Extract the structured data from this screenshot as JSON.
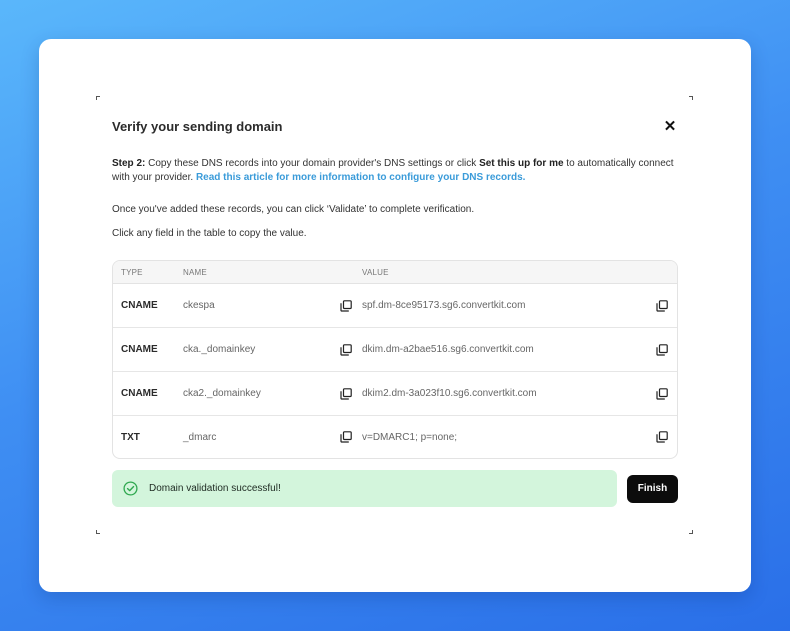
{
  "modal": {
    "title": "Verify your sending domain",
    "step_label": "Step 2:",
    "step_text_1": " Copy these DNS records into your domain provider's DNS settings or click ",
    "setup_label": "Set this up for me",
    "step_text_2": " to automatically connect with your provider. ",
    "article_link": "Read this article for more information to configure your DNS records.",
    "validate_note": "Once you've added these records, you can click ‘Validate’ to complete verification.",
    "copy_note": "Click any field in the table to copy the value."
  },
  "table": {
    "headers": {
      "type": "TYPE",
      "name": "NAME",
      "value": "VALUE"
    },
    "rows": [
      {
        "type": "CNAME",
        "name": "ckespa",
        "value": "spf.dm-8ce95173.sg6.convertkit.com"
      },
      {
        "type": "CNAME",
        "name": "cka._domainkey",
        "value": "dkim.dm-a2bae516.sg6.convertkit.com"
      },
      {
        "type": "CNAME",
        "name": "cka2._domainkey",
        "value": "dkim2.dm-3a023f10.sg6.convertkit.com"
      },
      {
        "type": "TXT",
        "name": "_dmarc",
        "value": "v=DMARC1; p=none;"
      }
    ]
  },
  "status": {
    "message": "Domain validation successful!",
    "icon": "check-circle-icon",
    "color": "#d3f5dc"
  },
  "actions": {
    "finish_label": "Finish"
  },
  "icons": {
    "close": "close-icon",
    "copy": "copy-icon"
  },
  "colors": {
    "accent_link": "#3a9bd9",
    "primary_button": "#0c0c0c",
    "success": "#2fa84f"
  }
}
